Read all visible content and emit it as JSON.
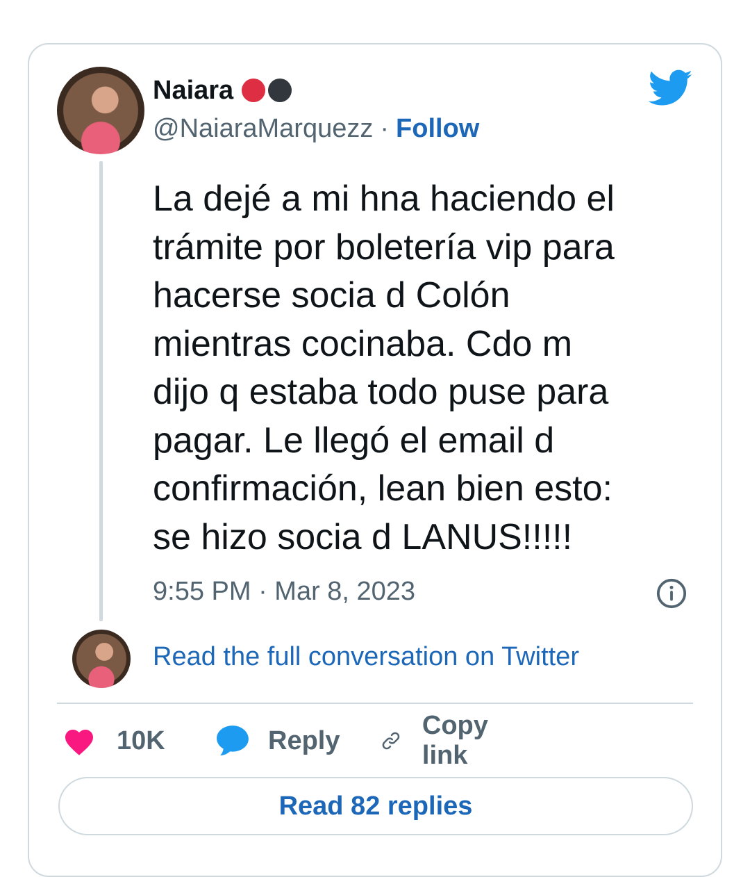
{
  "author": {
    "name": "Naiara",
    "handle": "@NaiaraMarquezz",
    "separator": "·",
    "follow_label": "Follow"
  },
  "tweet": {
    "text": "La dejé a mi hna haciendo el\ntrámite por boletería vip para\nhacerse socia d Colón\nmientras cocinaba. Cdo m\ndijo q estaba todo puse para\npagar. Le llegó el email d\nconfirmación, lean bien esto:\nse hizo socia d LANUS!!!!!",
    "timestamp": "9:55 PM · Mar 8, 2023"
  },
  "conversation": {
    "label": "Read the full conversation on Twitter"
  },
  "actions": {
    "likes": "10K",
    "reply_label": "Reply",
    "copy_link_label": "Copy link"
  },
  "read_replies_label": "Read 82 replies",
  "icons": {
    "brand": "twitter-bird-icon",
    "info": "info-icon",
    "like": "heart-icon",
    "reply": "speech-bubble-icon",
    "copy": "link-icon",
    "badge_dots": [
      "red-circle",
      "black-circle"
    ]
  },
  "colors": {
    "twitter_blue": "#1d9bf0",
    "link_blue": "#1d67b8",
    "heart_pink": "#f91880",
    "text_primary": "#0f1419",
    "text_secondary": "#536471",
    "border": "#cfd9de",
    "dot_red": "#dd2e44",
    "dot_black": "#31373d"
  }
}
